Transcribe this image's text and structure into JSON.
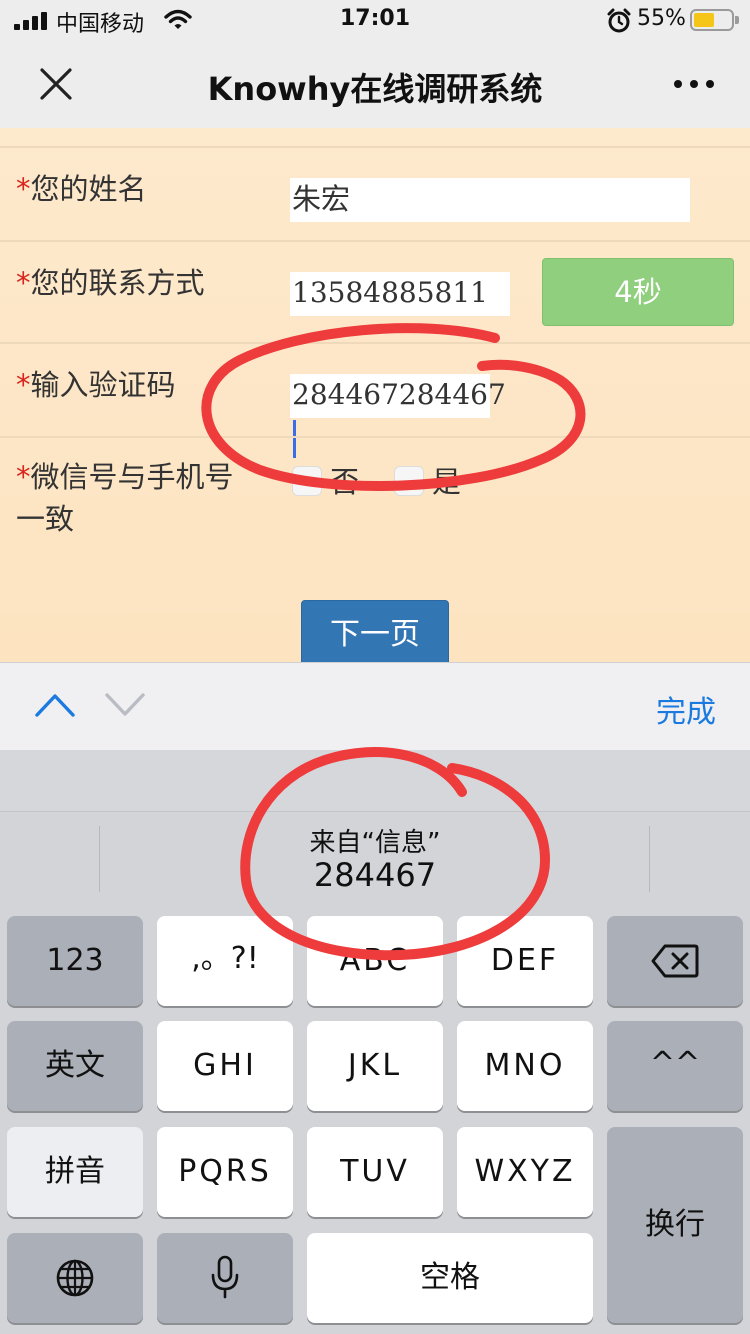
{
  "status_bar": {
    "carrier": "中国移动",
    "time": "17:01",
    "battery_percent": "55%",
    "battery_level": 0.55,
    "icons": [
      "signal-icon",
      "wifi-icon",
      "alarm-icon",
      "battery-icon"
    ]
  },
  "nav": {
    "title": "Knowhy在线调研系统",
    "close_icon": "close-icon",
    "more_icon": "more-icon"
  },
  "form": {
    "name": {
      "required_mark": "*",
      "label": "您的姓名",
      "value": "朱宏"
    },
    "contact": {
      "required_mark": "*",
      "label": "您的联系方式",
      "value": "13584885811",
      "countdown_label": "4秒"
    },
    "verify": {
      "required_mark": "*",
      "label": "输入验证码",
      "value": "284467284467"
    },
    "wechat_same": {
      "required_mark": "*",
      "label_line1": "微信号与手机号",
      "label_line2": "一致",
      "options": [
        "否",
        "是"
      ]
    },
    "next_label": "下一页"
  },
  "accessory": {
    "done_label": "完成",
    "icons": [
      "chevron-up-icon",
      "chevron-down-icon"
    ]
  },
  "keyboard": {
    "suggestion_source": "来自“信息”",
    "suggestion_code": "284467",
    "rows": [
      [
        "123",
        ",。?!",
        "ABC",
        "DEF",
        "backspace"
      ],
      [
        "英文",
        "GHI",
        "JKL",
        "MNO",
        "^^"
      ],
      [
        "拼音",
        "PQRS",
        "TUV",
        "WXYZ",
        "换行"
      ],
      [
        "globe",
        "mic",
        "空格"
      ]
    ],
    "keys": {
      "k123": "123",
      "punct": ",。?!",
      "abc": "ABC",
      "def": "DEF",
      "english": "英文",
      "ghi": "GHI",
      "jkl": "JKL",
      "mno": "MNO",
      "emoticon": "^^",
      "pinyin": "拼音",
      "pqrs": "PQRS",
      "tuv": "TUV",
      "wxyz": "WXYZ",
      "return": "换行",
      "space": "空格"
    },
    "icons": [
      "backspace-icon",
      "globe-icon",
      "microphone-icon"
    ]
  },
  "colors": {
    "form_background": "#fde6c6",
    "countdown_button": "#8fcf7d",
    "next_button": "#3376b4",
    "required_star": "#d9251d",
    "annotation_circle": "#ee3b3b",
    "done_blue": "#1a7ae0",
    "battery_yellow": "#f5c518"
  }
}
